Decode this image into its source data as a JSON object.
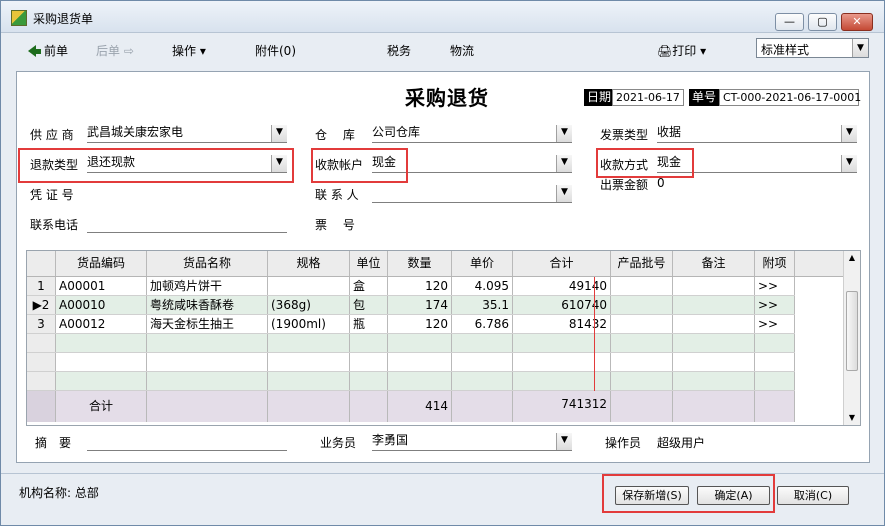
{
  "window": {
    "title": "采购退货单",
    "min": "—",
    "max": "▢",
    "close": "✕"
  },
  "toolbar": {
    "prev": "前单",
    "next": "后单",
    "actions": "操作",
    "attachments": "附件(0)",
    "tax": "税务",
    "logistics": "物流",
    "print": "打印",
    "style": "标准样式"
  },
  "doc": {
    "title": "采购退货",
    "date_label": "日期",
    "date_value": "2021-06-17",
    "no_label": "单号",
    "no_value": "CT-000-2021-06-17-0001"
  },
  "form": {
    "supplier_label": "供 应 商",
    "supplier": "武昌城关康宏家电",
    "warehouse_label": "仓　 库",
    "warehouse": "公司仓库",
    "invoice_type_label": "发票类型",
    "invoice_type": "收据",
    "refund_type_label": "退款类型",
    "refund_type": "退还现款",
    "account_label": "收款帐户",
    "account": "现金",
    "pay_method_label": "收款方式",
    "pay_method": "现金",
    "voucher_label": "凭 证 号",
    "contact_label": "联 系 人",
    "invoice_amount_label": "出票金额",
    "invoice_amount": "0",
    "phone_label": "联系电话",
    "ticket_label": "票　 号"
  },
  "grid": {
    "headers": [
      "",
      "货品编码",
      "货品名称",
      "规格",
      "单位",
      "数量",
      "单价",
      "合计",
      "产品批号",
      "备注",
      "附项"
    ],
    "rows": [
      {
        "no": "1",
        "code": "A00001",
        "name": "加顿鸡片饼干",
        "spec": "",
        "unit": "盒",
        "qty": "120",
        "price": "4.095",
        "total": "49140",
        "extra": ">>"
      },
      {
        "no": "2",
        "code": "A00010",
        "name": "粤统咸味香酥卷",
        "spec": "(368g)",
        "unit": "包",
        "qty": "174",
        "price": "35.1",
        "total": "610740",
        "extra": ">>"
      },
      {
        "no": "3",
        "code": "A00012",
        "name": "海天金标生抽王",
        "spec": "(1900ml)",
        "unit": "瓶",
        "qty": "120",
        "price": "6.786",
        "total": "81432",
        "extra": ">>"
      }
    ],
    "total_label": "合计",
    "total_qty": "414",
    "total_amount": "741312"
  },
  "footer": {
    "summary_label": "摘　要",
    "salesperson_label": "业务员",
    "salesperson": "李勇国",
    "operator_label": "操作员",
    "operator": "超级用户"
  },
  "status": {
    "org": "机构名称: 总部",
    "save_new": "保存新增(S)",
    "confirm": "确定(A)",
    "cancel": "取消(C)"
  }
}
